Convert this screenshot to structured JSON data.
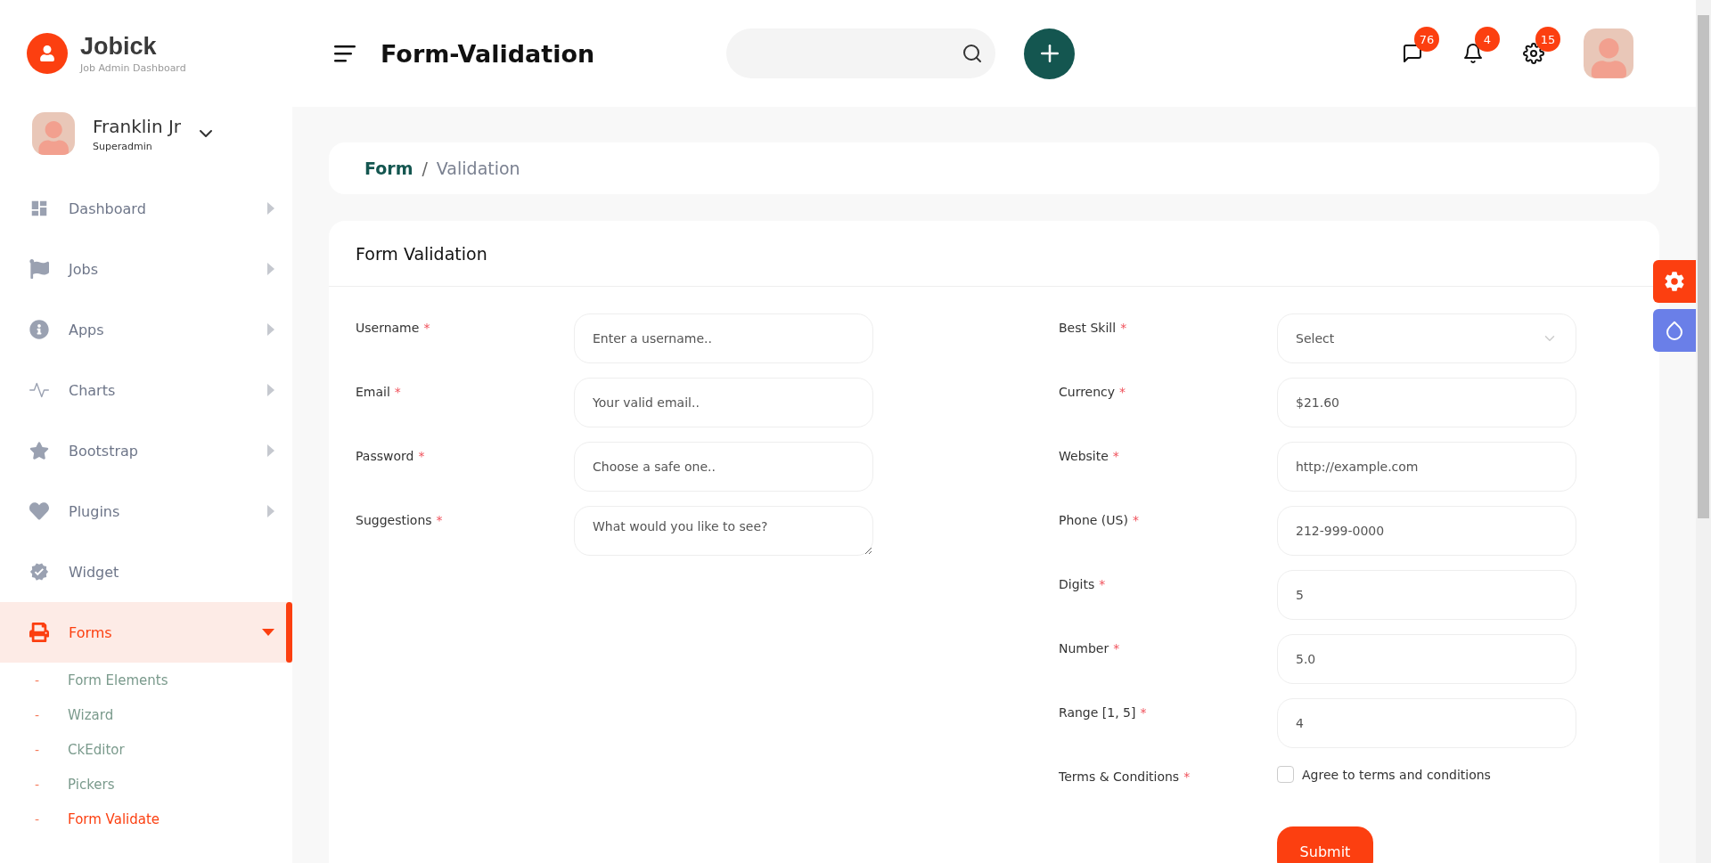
{
  "brand": {
    "name": "Jobick",
    "tagline": "Job Admin Dashboard"
  },
  "header": {
    "title": "Form-Validation",
    "badges": [
      "76",
      "4",
      "15"
    ]
  },
  "user": {
    "name": "Franklin Jr",
    "role": "Superadmin"
  },
  "sidebar": {
    "items": [
      {
        "label": "Dashboard",
        "kind": "submenu",
        "expanded": false,
        "selected": false
      },
      {
        "label": "Jobs",
        "kind": "submenu",
        "expanded": false,
        "selected": false
      },
      {
        "label": "Apps",
        "kind": "submenu",
        "expanded": false,
        "selected": false
      },
      {
        "label": "Charts",
        "kind": "submenu",
        "expanded": false,
        "selected": false
      },
      {
        "label": "Bootstrap",
        "kind": "submenu",
        "expanded": false,
        "selected": false
      },
      {
        "label": "Plugins",
        "kind": "submenu",
        "expanded": false,
        "selected": false
      },
      {
        "label": "Widget",
        "kind": "link",
        "selected": false
      },
      {
        "label": "Forms",
        "kind": "submenu",
        "expanded": true,
        "selected": true,
        "children": [
          {
            "marker": "-",
            "label": "Form Elements",
            "selected": false
          },
          {
            "marker": "-",
            "label": "Wizard",
            "selected": false
          },
          {
            "marker": "-",
            "label": "CkEditor",
            "selected": false
          },
          {
            "marker": "-",
            "label": "Pickers",
            "selected": false
          },
          {
            "marker": "-",
            "label": "Form Validate",
            "selected": true
          }
        ]
      }
    ]
  },
  "breadcrumb": {
    "items": [
      "Form",
      "Validation"
    ],
    "separator": "/"
  },
  "card": {
    "title": "Form Validation",
    "left_fields": [
      {
        "label": "Username",
        "required_mark": "*",
        "kind": "input",
        "placeholder": "Enter a username.."
      },
      {
        "label": "Email",
        "required_mark": "*",
        "kind": "input",
        "placeholder": "Your valid email.."
      },
      {
        "label": "Password",
        "required_mark": "*",
        "kind": "input",
        "placeholder": "Choose a safe one.."
      },
      {
        "label": "Suggestions",
        "required_mark": "*",
        "kind": "textarea",
        "placeholder": "What would you like to see?"
      }
    ],
    "right_fields": [
      {
        "label": "Best Skill",
        "required_mark": "*",
        "kind": "select",
        "value": "Select"
      },
      {
        "label": "Currency",
        "required_mark": "*",
        "kind": "input",
        "placeholder": "$21.60"
      },
      {
        "label": "Website",
        "required_mark": "*",
        "kind": "input",
        "placeholder": "http://example.com"
      },
      {
        "label": "Phone (US)",
        "required_mark": "*",
        "kind": "input",
        "placeholder": "212-999-0000"
      },
      {
        "label": "Digits",
        "required_mark": "*",
        "kind": "input",
        "placeholder": "5"
      },
      {
        "label": "Number",
        "required_mark": "*",
        "kind": "input",
        "placeholder": "5.0"
      },
      {
        "label": "Range [1, 5]",
        "required_mark": "*",
        "kind": "input",
        "placeholder": "4"
      },
      {
        "label": "Terms & Conditions",
        "required_mark": "*",
        "kind": "checkbox",
        "text": "Agree to terms and conditions",
        "checked": false
      }
    ],
    "submit": "Submit"
  }
}
